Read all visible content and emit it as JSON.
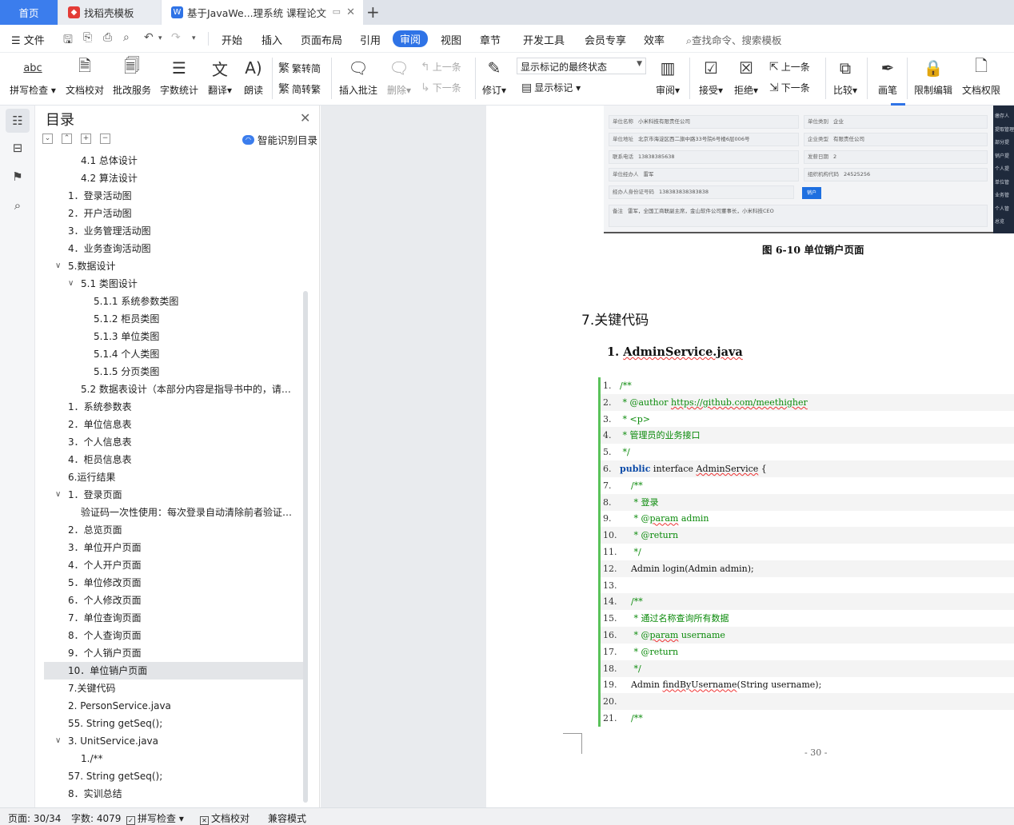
{
  "tabs": [
    {
      "label": "首页"
    },
    {
      "label": "找稻壳模板"
    },
    {
      "label": "基于JavaWe...理系统 课程论文"
    }
  ],
  "menu": {
    "main_label": "文件",
    "items": [
      "开始",
      "插入",
      "页面布局",
      "引用",
      "审阅",
      "视图",
      "章节",
      "开发工具",
      "会员专享",
      "效率"
    ],
    "active": "审阅",
    "search_placeholder": "查找命令、搜索模板"
  },
  "ribbon": {
    "spell_check": "拼写检查",
    "doc_proof": "文档校对",
    "batch_service": "批改服务",
    "word_count": "字数统计",
    "translate": "翻译",
    "read_aloud": "朗读",
    "trad_to_simp": "繁转简",
    "simp_to_trad": "简转繁",
    "insert_comment": "插入批注",
    "delete": "删除",
    "prev_comment": "上一条",
    "next_comment": "下一条",
    "revise": "修订",
    "markup_state": "显示标记的最终状态",
    "show_markup": "显示标记",
    "review": "审阅",
    "accept": "接受",
    "reject": "拒绝",
    "prev_change": "上一条",
    "next_change": "下一条",
    "compare": "比较",
    "pen": "画笔",
    "restrict_edit": "限制编辑",
    "doc_permission": "文档权限"
  },
  "toc": {
    "title": "目录",
    "smart_recognize": "智能识别目录",
    "items": [
      {
        "text": "4.1  总体设计",
        "level": 2
      },
      {
        "text": "4.2  算法设计",
        "level": 2
      },
      {
        "text": "1．登录活动图",
        "level": 1
      },
      {
        "text": "2．开户活动图",
        "level": 1
      },
      {
        "text": "3．业务管理活动图",
        "level": 1
      },
      {
        "text": "4．业务查询活动图",
        "level": 1
      },
      {
        "text": "5.数据设计",
        "level": 1,
        "expanded": true
      },
      {
        "text": "5.1  类图设计",
        "level": 2,
        "expanded": true
      },
      {
        "text": "5.1.1  系统参数类图",
        "level": 3
      },
      {
        "text": "5.1.2  柜员类图",
        "level": 3
      },
      {
        "text": "5.1.3  单位类图",
        "level": 3
      },
      {
        "text": "5.1.4  个人类图",
        "level": 3
      },
      {
        "text": "5.1.5  分页类图",
        "level": 3
      },
      {
        "text": "5.2  数据表设计（本部分内容是指导书中的，请以实际为准）",
        "level": 2
      },
      {
        "text": "1．系统参数表",
        "level": 1
      },
      {
        "text": "2．单位信息表",
        "level": 1
      },
      {
        "text": "3．个人信息表",
        "level": 1
      },
      {
        "text": "4．柜员信息表",
        "level": 1
      },
      {
        "text": "6.运行结果",
        "level": 1
      },
      {
        "text": "1．登录页面",
        "level": 1,
        "expanded": true
      },
      {
        "text": "验证码一次性使用：每次登录自动清除前者验证码，保证安全性",
        "level": 2
      },
      {
        "text": "2．总览页面",
        "level": 1
      },
      {
        "text": "3．单位开户页面",
        "level": 1
      },
      {
        "text": "4．个人开户页面",
        "level": 1
      },
      {
        "text": "5．单位修改页面",
        "level": 1
      },
      {
        "text": "6．个人修改页面",
        "level": 1
      },
      {
        "text": "7．单位查询页面",
        "level": 1
      },
      {
        "text": "8．个人查询页面",
        "level": 1
      },
      {
        "text": "9．个人销户页面",
        "level": 1
      },
      {
        "text": "10．单位销户页面",
        "level": 1,
        "selected": true
      },
      {
        "text": "7.关键代码",
        "level": 1
      },
      {
        "text": "2. PersonService.java",
        "level": 1
      },
      {
        "text": "55.    String getSeq();",
        "level": 1
      },
      {
        "text": "3. UnitService.java",
        "level": 1,
        "expanded": true
      },
      {
        "text": "1./**",
        "level": 2
      },
      {
        "text": "57.    String getSeq();",
        "level": 1
      },
      {
        "text": "8．实训总结",
        "level": 1
      }
    ]
  },
  "doc": {
    "screenshot_fields": [
      {
        "label": "单位名称",
        "value": "小米科技有限责任公司"
      },
      {
        "label": "单位类别",
        "value": "企业"
      },
      {
        "label": "单位地址",
        "value": "北京市海淀区西二旗中路33号院6号楼6层006号"
      },
      {
        "label": "企业类型",
        "value": "有限责任公司"
      },
      {
        "label": "联系电话",
        "value": "13838385638"
      },
      {
        "label": "发薪日期",
        "value": "2"
      },
      {
        "label": "单位经办人",
        "value": "雷军"
      },
      {
        "label": "组织机构代码",
        "value": "24525256"
      },
      {
        "label": "经办人身份证号码",
        "value": "138383838383838"
      },
      {
        "label": "备注",
        "value": "雷军，全国工商联副主席，金山软件公司董事长，小米科技CEO"
      }
    ],
    "screenshot_button": "销户",
    "screenshot_sidebar": [
      "缴存人",
      "提取管理",
      "部分提",
      "销户提",
      "个人提",
      "单位管",
      "业务管",
      "个人管",
      "总览"
    ],
    "figure_caption": "图 6-10  单位销户页面",
    "section_heading": "7.关键代码",
    "sub_heading_num": "1. ",
    "sub_heading_file": "AdminService.java",
    "code_lines": [
      {
        "n": "1.",
        "segs": [
          {
            "t": "/**",
            "c": "cm"
          }
        ]
      },
      {
        "n": "2.",
        "segs": [
          {
            "t": " * @author ",
            "c": "cm"
          },
          {
            "t": "https://github.com/meethigher",
            "c": "cm wv"
          }
        ]
      },
      {
        "n": "3.",
        "segs": [
          {
            "t": " * <p>",
            "c": "cm"
          }
        ]
      },
      {
        "n": "4.",
        "segs": [
          {
            "t": " * 管理员的业务接口",
            "c": "cm"
          }
        ]
      },
      {
        "n": "5.",
        "segs": [
          {
            "t": " */",
            "c": "cm"
          }
        ]
      },
      {
        "n": "6.",
        "segs": [
          {
            "t": "public",
            "c": "kw"
          },
          {
            "t": " interface ",
            "c": ""
          },
          {
            "t": "AdminService",
            "c": "wv"
          },
          {
            "t": " {",
            "c": ""
          }
        ]
      },
      {
        "n": "7.",
        "segs": [
          {
            "t": "    /**",
            "c": "cm"
          }
        ]
      },
      {
        "n": "8.",
        "segs": [
          {
            "t": "     * 登录",
            "c": "cm"
          }
        ]
      },
      {
        "n": "9.",
        "segs": [
          {
            "t": "     * @",
            "c": "cm"
          },
          {
            "t": "param",
            "c": "cm wv"
          },
          {
            "t": " admin",
            "c": "cm"
          }
        ]
      },
      {
        "n": "10.",
        "segs": [
          {
            "t": "     * @return",
            "c": "cm"
          }
        ]
      },
      {
        "n": "11.",
        "segs": [
          {
            "t": "     */",
            "c": "cm"
          }
        ]
      },
      {
        "n": "12.",
        "segs": [
          {
            "t": "    Admin login(Admin admin);",
            "c": ""
          }
        ]
      },
      {
        "n": "13.",
        "segs": []
      },
      {
        "n": "14.",
        "segs": [
          {
            "t": "    /**",
            "c": "cm"
          }
        ]
      },
      {
        "n": "15.",
        "segs": [
          {
            "t": "     * 通过名称查询所有数据",
            "c": "cm"
          }
        ]
      },
      {
        "n": "16.",
        "segs": [
          {
            "t": "     * @",
            "c": "cm"
          },
          {
            "t": "param",
            "c": "cm wv"
          },
          {
            "t": " username",
            "c": "cm"
          }
        ]
      },
      {
        "n": "17.",
        "segs": [
          {
            "t": "     * @return",
            "c": "cm"
          }
        ]
      },
      {
        "n": "18.",
        "segs": [
          {
            "t": "     */",
            "c": "cm"
          }
        ]
      },
      {
        "n": "19.",
        "segs": [
          {
            "t": "    Admin ",
            "c": ""
          },
          {
            "t": "findByUsername",
            "c": "wv"
          },
          {
            "t": "(String username);",
            "c": ""
          }
        ]
      },
      {
        "n": "20.",
        "segs": []
      },
      {
        "n": "21.",
        "segs": [
          {
            "t": "    /**",
            "c": "cm"
          }
        ]
      }
    ],
    "page_number": "- 30 -"
  },
  "status": {
    "page": "页面: 30/34",
    "words": "字数: 4079",
    "spell": "拼写检查",
    "proof": "文档校对",
    "compat": "兼容模式"
  },
  "colors": {
    "accent": "#2f73e6",
    "change_bar": "#5ac25a",
    "comment_green": "#0a8a0a"
  }
}
